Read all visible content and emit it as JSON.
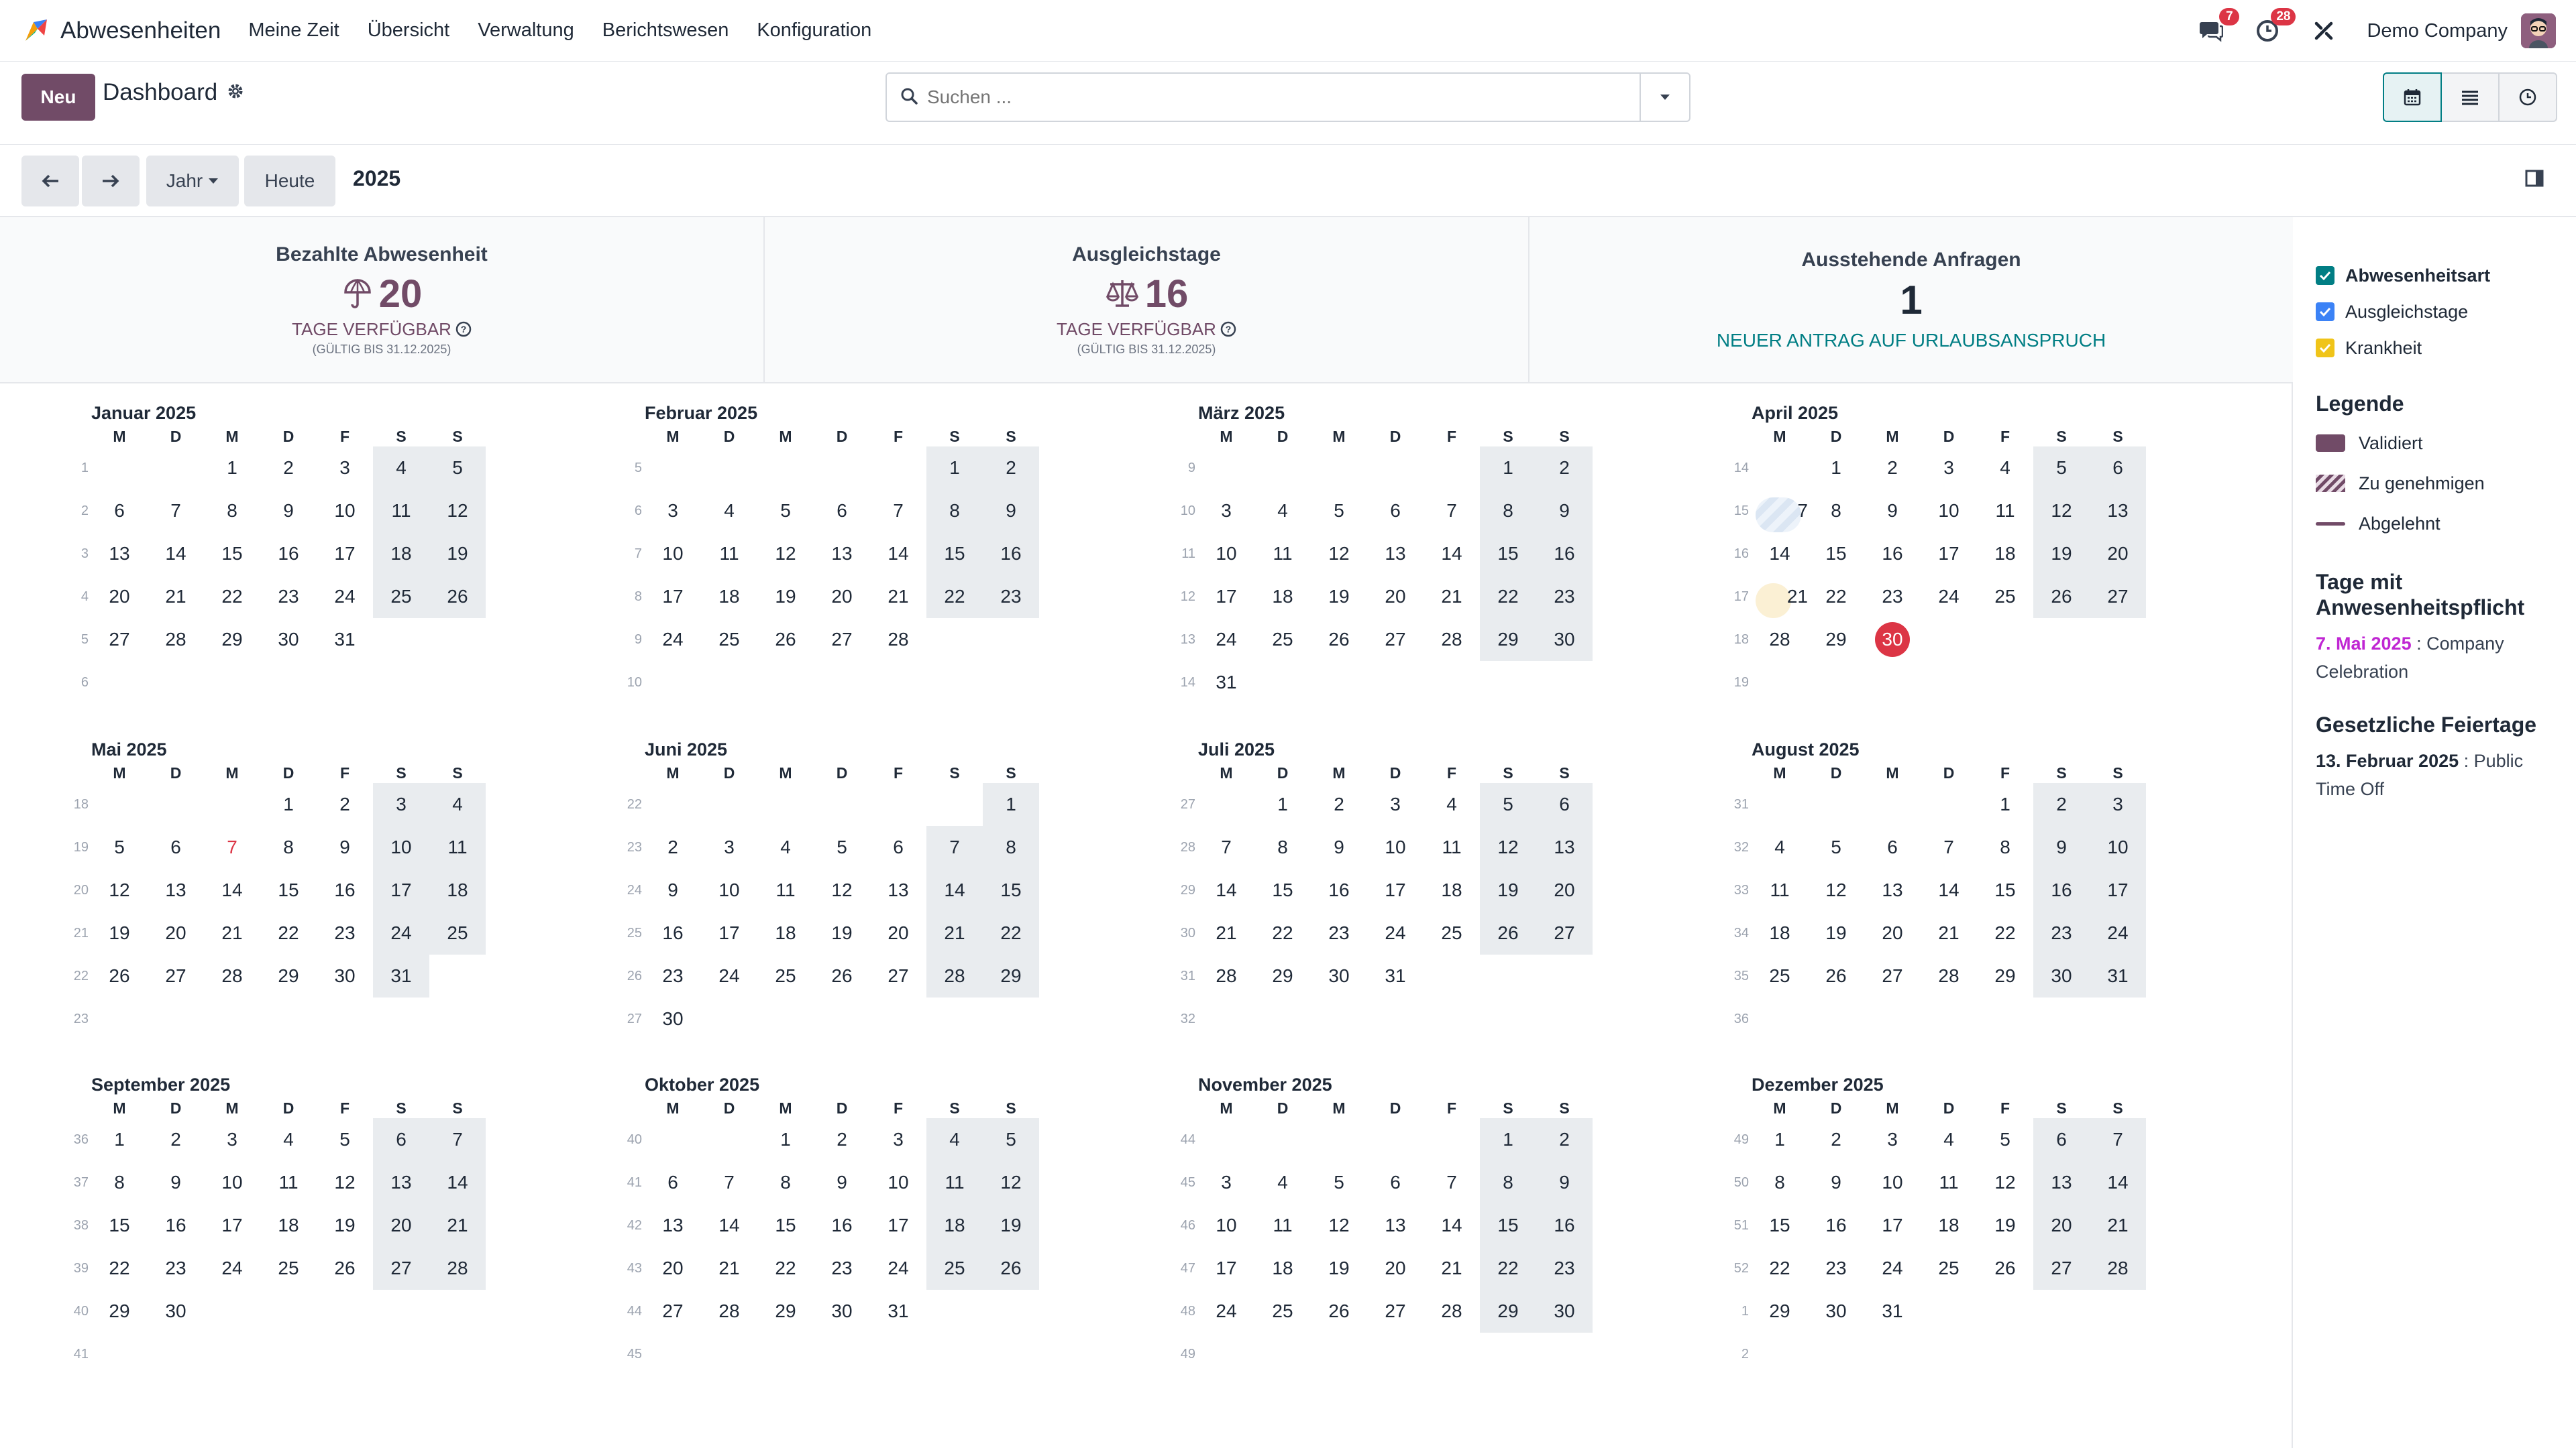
{
  "app": {
    "title": "Abwesenheiten"
  },
  "menu": [
    "Meine Zeit",
    "Übersicht",
    "Verwaltung",
    "Berichtswesen",
    "Konfiguration"
  ],
  "topbar": {
    "chat_badge": "7",
    "activity_badge": "28",
    "company": "Demo Company"
  },
  "control": {
    "new_label": "Neu",
    "breadcrumb": "Dashboard",
    "search_placeholder": "Suchen ..."
  },
  "nav": {
    "scale_label": "Jahr",
    "today_label": "Heute",
    "period": "2025"
  },
  "summary": [
    {
      "title": "Bezahlte Abwesenheit",
      "value": "20",
      "sub": "TAGE VERFÜGBAR",
      "small": "(GÜLTIG BIS 31.12.2025)"
    },
    {
      "title": "Ausgleichstage",
      "value": "16",
      "sub": "TAGE VERFÜGBAR",
      "small": "(GÜLTIG BIS 31.12.2025)"
    },
    {
      "title": "Ausstehende Anfragen",
      "value": "1",
      "link": "NEUER ANTRAG AUF URLAUBSANSPRUCH"
    }
  ],
  "weekday_labels": [
    "M",
    "D",
    "M",
    "D",
    "F",
    "S",
    "S"
  ],
  "months": [
    {
      "title": "Januar 2025",
      "weeks": [
        "1",
        "2",
        "3",
        "4",
        "5",
        "6"
      ]
    },
    {
      "title": "Februar 2025",
      "weeks": [
        "5",
        "6",
        "7",
        "8",
        "9",
        "10"
      ]
    },
    {
      "title": "März 2025",
      "weeks": [
        "9",
        "10",
        "11",
        "12",
        "13",
        "14"
      ]
    },
    {
      "title": "April 2025",
      "weeks": [
        "14",
        "15",
        "16",
        "17",
        "18",
        "19"
      ]
    },
    {
      "title": "Mai 2025",
      "weeks": [
        "18",
        "19",
        "20",
        "21",
        "22",
        "23"
      ]
    },
    {
      "title": "Juni 2025",
      "weeks": [
        "22",
        "23",
        "24",
        "25",
        "26",
        "27"
      ]
    },
    {
      "title": "Juli 2025",
      "weeks": [
        "27",
        "28",
        "29",
        "30",
        "31",
        "32"
      ]
    },
    {
      "title": "August 2025",
      "weeks": [
        "31",
        "32",
        "33",
        "34",
        "35",
        "36"
      ]
    },
    {
      "title": "September 2025",
      "weeks": [
        "36",
        "37",
        "38",
        "39",
        "40",
        "41"
      ]
    },
    {
      "title": "Oktober 2025",
      "weeks": [
        "40",
        "41",
        "42",
        "43",
        "44",
        "45"
      ]
    },
    {
      "title": "November 2025",
      "weeks": [
        "44",
        "45",
        "46",
        "47",
        "48",
        "49"
      ]
    },
    {
      "title": "Dezember 2025",
      "weeks": [
        "49",
        "50",
        "51",
        "52",
        "1",
        "2"
      ]
    }
  ],
  "sidebar": {
    "filters": [
      {
        "label": "Abwesenheitsart",
        "color": "#017e84",
        "bold": true
      },
      {
        "label": "Ausgleichstage",
        "color": "#3b82f6",
        "bold": false
      },
      {
        "label": "Krankheit",
        "color": "#f0c419",
        "bold": false
      }
    ],
    "legend_title": "Legende",
    "legend": [
      {
        "label": "Validiert",
        "style": "solid"
      },
      {
        "label": "Zu genehmigen",
        "style": "hatched"
      },
      {
        "label": "Abgelehnt",
        "style": "line"
      }
    ],
    "mandatory_title": "Tage mit Anwesenheitspflicht",
    "mandatory_date": "7. Mai 2025",
    "mandatory_text": " : Company Celebration",
    "holidays_title": "Gesetzliche Feiertage",
    "holiday_date": "13. Februar 2025",
    "holiday_text": " : Public Time Off"
  },
  "colors": {
    "brand": "#714b67",
    "accent": "#017e84",
    "today": "#dc3545",
    "validated": "#714b67",
    "pending_hatch": "#dbe6f3",
    "yellow": "#fbf0d4"
  },
  "highlights": {
    "today": {
      "month": 3,
      "day": 30
    },
    "mandatory_day": {
      "month": 4,
      "day": 7
    },
    "pending_range": {
      "month": 3,
      "start": 7,
      "end": 9
    },
    "sick_range": {
      "month": 3,
      "start": 21,
      "end": 23
    }
  }
}
